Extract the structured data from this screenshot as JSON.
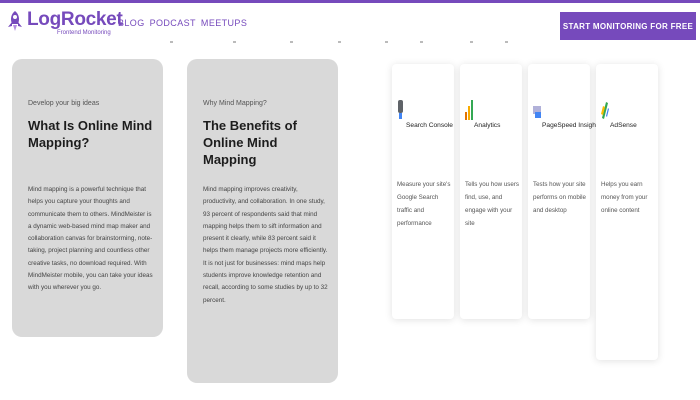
{
  "brand": {
    "name": "LogRocket",
    "tagline": "Frontend Monitoring",
    "accent": "#764abc"
  },
  "nav": {
    "items": [
      "BLOG",
      "PODCAST",
      "MEETUPS"
    ]
  },
  "cta": {
    "label": "START MONITORING FOR FREE"
  },
  "cards": [
    {
      "eyebrow": "Develop your big ideas",
      "title": "What Is Online Mind Mapping?",
      "body": "Mind mapping is a powerful technique that helps you capture your thoughts and communicate them to others. MindMeister is a dynamic web-based mind map maker and collaboration canvas for brainstorming, note-taking, project planning and countless other creative tasks, no download required. With MindMeister mobile, you can take your ideas with you wherever you go."
    },
    {
      "eyebrow": "Why Mind Mapping?",
      "title": "The Benefits of Online Mind Mapping",
      "body": "Mind mapping improves creativity, productivity, and collaboration. In one study, 93 percent of respondents said that mind mapping helps them to sift information and present it clearly, while 83 percent said it helps them manage projects more efficiently. It is not just for businesses: mind maps help students improve knowledge retention and recall, according to some studies by up to 32 percent."
    }
  ],
  "products": [
    {
      "name": "Search Console",
      "description": "Measure your site's Google Search traffic and performance",
      "icon": "search-console-icon",
      "color": "#4285f4"
    },
    {
      "name": "Analytics",
      "description": "Tells you how users find, use, and engage with your site",
      "icon": "analytics-icon",
      "color": "#f9ab00"
    },
    {
      "name": "PageSpeed Insights",
      "description": "Tests how your site performs on mobile and desktop",
      "icon": "pagespeed-icon",
      "color": "#4285f4"
    },
    {
      "name": "AdSense",
      "description": "Helps you earn money from your online content",
      "icon": "adsense-icon",
      "color": "#34a853"
    }
  ]
}
